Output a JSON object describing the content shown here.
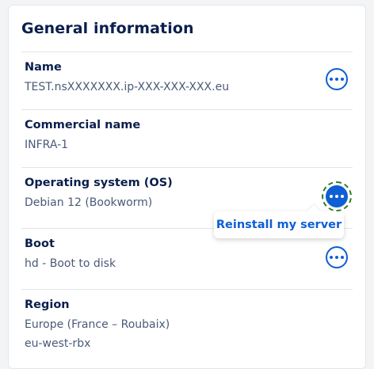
{
  "card": {
    "title": "General information"
  },
  "fields": [
    {
      "label": "Name",
      "value": "TEST.nsXXXXXXX.ip-XXX-XXX-XXX.eu"
    },
    {
      "label": "Commercial name",
      "value": "INFRA-1"
    },
    {
      "label": "Operating system (OS)",
      "value": "Debian 12 (Bookworm)"
    },
    {
      "label": "Boot",
      "value": "hd - Boot to disk"
    },
    {
      "label": "Region",
      "value": "Europe (France – Roubaix)",
      "value2": "eu-west-rbx"
    }
  ],
  "os_menu": {
    "item": "Reinstall my server"
  },
  "icons": {
    "action": "more-options-icon"
  },
  "colors": {
    "primary": "#0e5fd3",
    "heading": "#0b1f4d",
    "muted": "#4a5a78",
    "focus": "#2f7d1f"
  }
}
